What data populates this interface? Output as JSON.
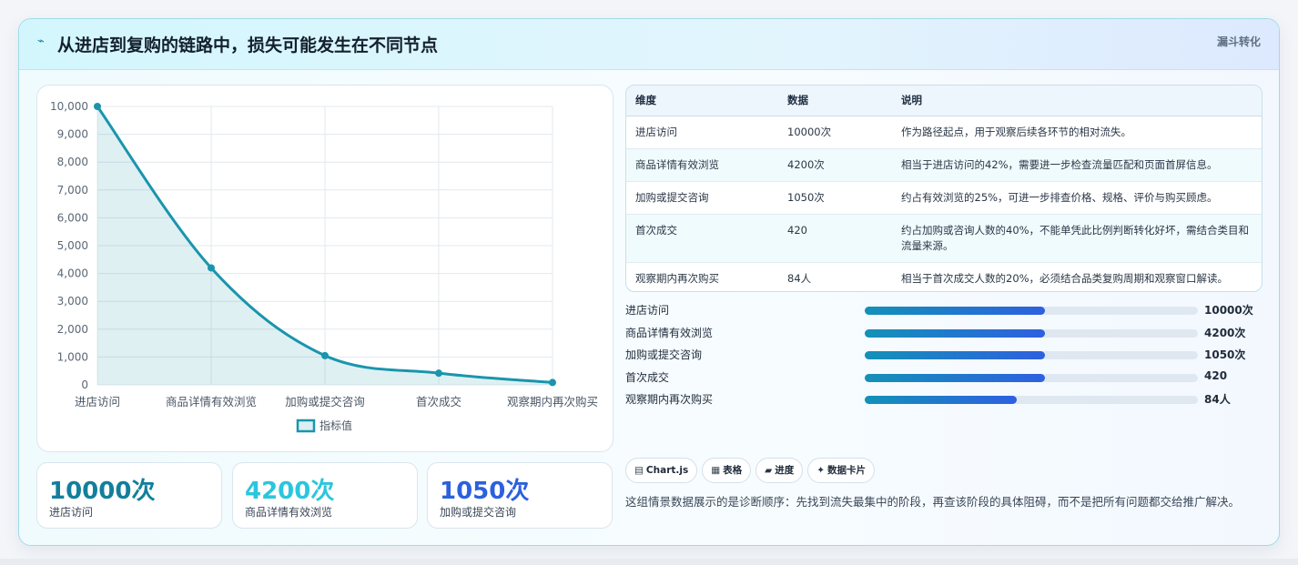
{
  "header": {
    "icon": "bolt-icon",
    "title": "从进店到复购的链路中，损失可能发生在不同节点",
    "tag": "漏斗转化"
  },
  "chart_data": {
    "type": "line",
    "categories": [
      "进店访问",
      "商品详情有效浏览",
      "加购或提交咨询",
      "首次成交",
      "观察期内再次购买"
    ],
    "series": [
      {
        "name": "指标值",
        "values": [
          10000,
          4200,
          1050,
          420,
          84
        ]
      }
    ],
    "ylim": [
      0,
      10000
    ],
    "yticks": [
      "10,000",
      "9,000",
      "8,000",
      "7,000",
      "6,000",
      "5,000",
      "4,000",
      "3,000",
      "2,000",
      "1,000",
      "0"
    ],
    "grid": true,
    "legend": "bottom",
    "color": "#1a95ad"
  },
  "stats": [
    {
      "value": "10000次",
      "label": "进店访问",
      "color": "#127f9c"
    },
    {
      "value": "4200次",
      "label": "商品详情有效浏览",
      "color": "#2bc6dd"
    },
    {
      "value": "1050次",
      "label": "加购或提交咨询",
      "color": "#2c60dc"
    }
  ],
  "table": {
    "headers": [
      "维度",
      "数据",
      "说明"
    ],
    "rows": [
      [
        "进店访问",
        "10000次",
        "作为路径起点，用于观察后续各环节的相对流失。"
      ],
      [
        "商品详情有效浏览",
        "4200次",
        "相当于进店访问的42%，需要进一步检查流量匹配和页面首屏信息。"
      ],
      [
        "加购或提交咨询",
        "1050次",
        "约占有效浏览的25%，可进一步排查价格、规格、评价与购买顾虑。"
      ],
      [
        "首次成交",
        "420",
        "约占加购或咨询人数的40%，不能单凭此比例判断转化好坏，需结合类目和流量来源。"
      ],
      [
        "观察期内再次购买",
        "84人",
        "相当于首次成交人数的20%，必须结合品类复购周期和观察窗口解读。"
      ]
    ]
  },
  "bars": [
    {
      "name": "进店访问",
      "value": "10000次",
      "fill": 0.54
    },
    {
      "name": "商品详情有效浏览",
      "value": "4200次",
      "fill": 0.54
    },
    {
      "name": "加购或提交咨询",
      "value": "1050次",
      "fill": 0.54
    },
    {
      "name": "首次成交",
      "value": "420",
      "fill": 0.54
    },
    {
      "name": "观察期内再次购买",
      "value": "84人",
      "fill": 0.455
    }
  ],
  "chips": [
    {
      "icon": "▤",
      "label": "Chart.js"
    },
    {
      "icon": "▦",
      "label": "表格"
    },
    {
      "icon": "▰",
      "label": "进度"
    },
    {
      "icon": "✦",
      "label": "数据卡片"
    }
  ],
  "note": "这组情景数据展示的是诊断顺序：先找到流失最集中的阶段，再查该阶段的具体阻碍，而不是把所有问题都交给推广解决。"
}
